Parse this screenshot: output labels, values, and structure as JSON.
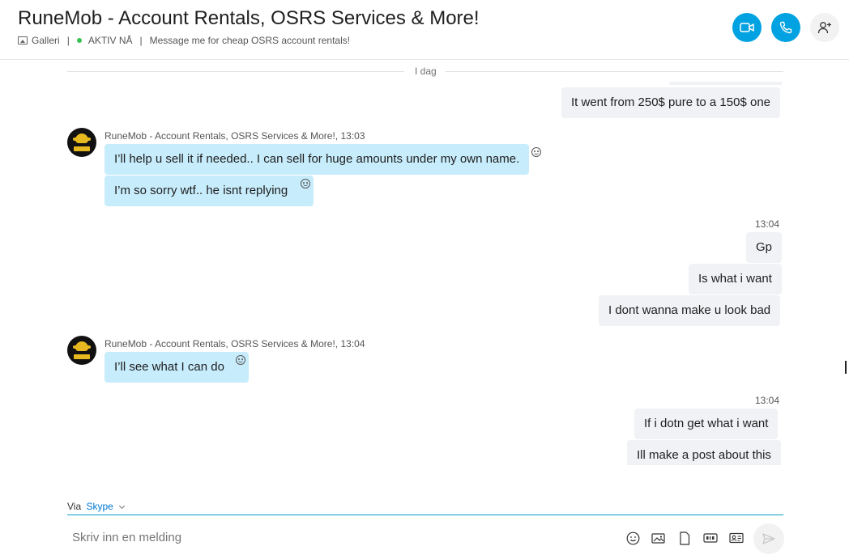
{
  "header": {
    "title": "RuneMob - Account Rentals, OSRS Services & More!",
    "gallery_label": "Galleri",
    "status_label": "AKTIV NÅ",
    "mood_message": "Message me for cheap OSRS account rentals!",
    "separator": "|"
  },
  "conversation": {
    "day_divider": "I dag",
    "messages": [
      {
        "direction": "out",
        "text": "It went from 250$ pure to a 150$ one"
      },
      {
        "direction": "in",
        "sender": "RuneMob - Account Rentals, OSRS Services & More!,",
        "time": "13:03",
        "text": "I’ll help u sell it if needed.. I can sell for huge amounts under my own name."
      },
      {
        "direction": "in",
        "text": "I’m so sorry wtf.. he isnt replying"
      },
      {
        "direction": "out",
        "time": "13:04",
        "text": "Gp"
      },
      {
        "direction": "out",
        "text": "Is what i want"
      },
      {
        "direction": "out",
        "text": "I dont wanna make u look bad"
      },
      {
        "direction": "in",
        "sender": "RuneMob - Account Rentals, OSRS Services & More!,",
        "time": "13:04",
        "text": "I’ll see what I can do"
      },
      {
        "direction": "out",
        "time": "13:04",
        "text": "If i dotn get what i want"
      },
      {
        "direction": "out",
        "text": "Ill make a post about this"
      }
    ]
  },
  "compose": {
    "via_label": "Via",
    "service": "Skype",
    "placeholder": "Skriv inn en melding"
  },
  "colors": {
    "accent": "#00a2e2",
    "incoming_bubble": "#c7ecfb",
    "outgoing_bubble": "#f0f2f5",
    "online": "#39c152"
  },
  "icons": {
    "video_call": "video-camera-icon",
    "audio_call": "phone-icon",
    "add_people": "add-person-icon",
    "emoji": "smiley-icon",
    "media": "image-icon",
    "file": "file-icon",
    "gif": "gif-icon",
    "contact": "contact-card-icon",
    "send": "send-icon"
  }
}
